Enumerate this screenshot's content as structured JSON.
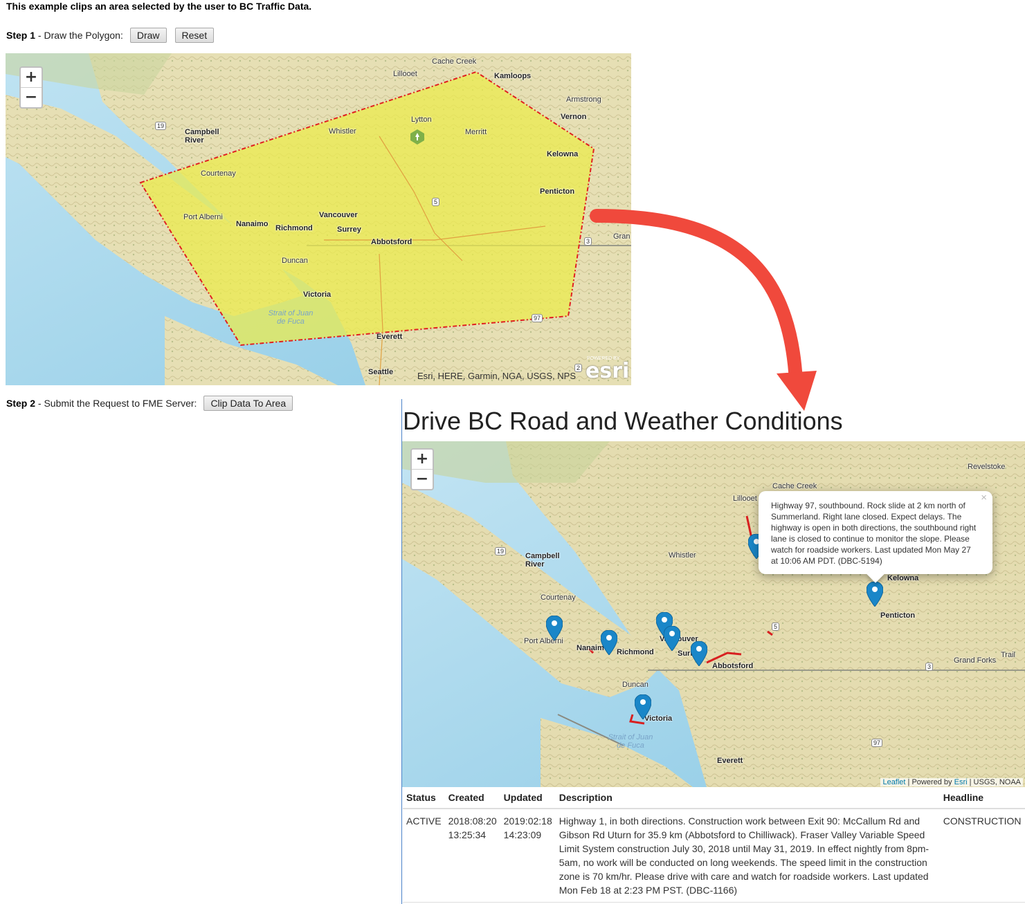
{
  "intro": "This example clips an area selected by the user to BC Traffic Data.",
  "step1": {
    "label": "Step 1",
    "text": " - Draw the Polygon:",
    "draw": "Draw",
    "reset": "Reset"
  },
  "step2": {
    "label": "Step 2",
    "text": " - Submit the Request to FME Server:",
    "clip": "Clip Data To Area"
  },
  "map1": {
    "zoom_in": "+",
    "zoom_out": "−",
    "polygon_fill": "#ecec4a",
    "polygon_stroke": "#e02020",
    "cities": {
      "cache_creek": "Cache Creek",
      "lillooet": "Lillooet",
      "kamloops": "Kamloops",
      "armstrong": "Armstrong",
      "vernon": "Vernon",
      "lytton": "Lytton",
      "merritt": "Merritt",
      "campbell_river": "Campbell River",
      "whistler": "Whistler",
      "kelowna": "Kelowna",
      "courtenay": "Courtenay",
      "penticton": "Penticton",
      "port_alberni": "Port Alberni",
      "nanaimo": "Nanaimo",
      "richmond": "Richmond",
      "vancouver": "Vancouver",
      "surrey": "Surrey",
      "abbotsford": "Abbotsford",
      "grand": "Gran",
      "duncan": "Duncan",
      "victoria": "Victoria",
      "everett": "Everett",
      "seattle": "Seattle"
    },
    "water": "Strait of Juan de Fuca",
    "shields": {
      "h19": "19",
      "h5": "5",
      "h3": "3",
      "h97": "97",
      "h2": "2"
    },
    "attribution": "Esri, HERE, Garmin, NGA, USGS, NPS",
    "powered_by": "POWERED BY",
    "esri_logo": "esri"
  },
  "results": {
    "title": "Drive BC Road and Weather Conditions",
    "map": {
      "zoom_in": "+",
      "zoom_out": "−",
      "cities": {
        "revelstoke": "Revelstoke",
        "cache_creek": "Cache Creek",
        "lillooet": "Lillooet",
        "campbell_river": "Campbell River",
        "whistler": "Whistler",
        "kelowna": "Kelowna",
        "courtenay": "Courtenay",
        "penticton": "Penticton",
        "port_alberni": "Port Alberni",
        "nanaimo": "Nanaimo",
        "richmond": "Richmond",
        "vancouver": "Vancouver",
        "surrey": "Surrey",
        "abbotsford": "Abbotsford",
        "grand_forks": "Grand Forks",
        "trail": "Trail",
        "duncan": "Duncan",
        "victoria": "Victoria",
        "everett": "Everett"
      },
      "water": "Strait of Juan de Fuca",
      "shields": {
        "h19": "19",
        "h5": "5",
        "h3": "3",
        "h97": "97"
      },
      "attribution": {
        "leaflet": "Leaflet",
        "sep1": " | Powered by ",
        "esri": "Esri",
        "rest": " | USGS, NOAA"
      },
      "marker_color": "#1a86c8"
    },
    "popup": {
      "text": "Highway 97, southbound. Rock slide at 2 km north of Summerland. Right lane closed. Expect delays. The highway is open in both directions, the southbound right lane is closed to continue to monitor the slope. Please watch for roadside workers. Last updated Mon May 27 at 10:06 AM PDT. (DBC-5194)",
      "close": "×"
    },
    "table": {
      "headers": [
        "Status",
        "Created",
        "Updated",
        "Description",
        "Headline"
      ],
      "rows": [
        {
          "status": "ACTIVE",
          "created_date": "2018:08:20",
          "created_time": "13:25:34",
          "updated_date": "2019:02:18",
          "updated_time": "14:23:09",
          "description": "Highway 1, in both directions. Construction work between Exit 90: McCallum Rd and Gibson Rd Uturn for 35.9 km (Abbotsford to Chilliwack). Fraser Valley Variable Speed Limit System construction July 30, 2018 until May 31, 2019. In effect nightly from 8pm-5am, no work will be conducted on long weekends. The speed limit in the construction zone is 70 km/hr. Please drive with care and watch for roadside workers. Last updated Mon Feb 18 at 2:23 PM PST. (DBC-1166)",
          "headline": "CONSTRUCTION"
        }
      ]
    }
  },
  "arrow_color": "#f0493c"
}
